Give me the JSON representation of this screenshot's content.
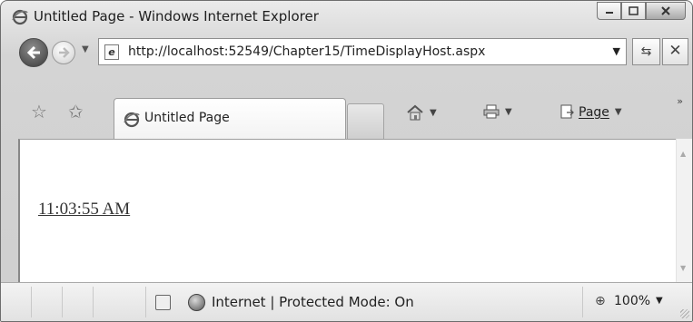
{
  "window": {
    "title": "Untitled Page - Windows Internet Explorer"
  },
  "address_bar": {
    "url": "http://localhost:52549/Chapter15/TimeDisplayHost.aspx"
  },
  "tabs": [
    {
      "label": "Untitled Page"
    }
  ],
  "command_bar": {
    "page_label": "Page"
  },
  "content": {
    "time_text": "11:03:55 AM"
  },
  "status_bar": {
    "zone_text": "Internet | Protected Mode: On",
    "zoom": "100%"
  },
  "icons": {
    "title": "ie-logo-icon",
    "back": "back-arrow-icon",
    "forward": "forward-arrow-icon",
    "favorites": "favorites-star-icon",
    "add_favorites": "add-favorites-icon",
    "home": "home-icon",
    "print": "print-icon",
    "page": "page-icon",
    "refresh": "refresh-icon",
    "stop": "stop-icon",
    "zone": "globe-icon",
    "zoom": "zoom-icon"
  }
}
